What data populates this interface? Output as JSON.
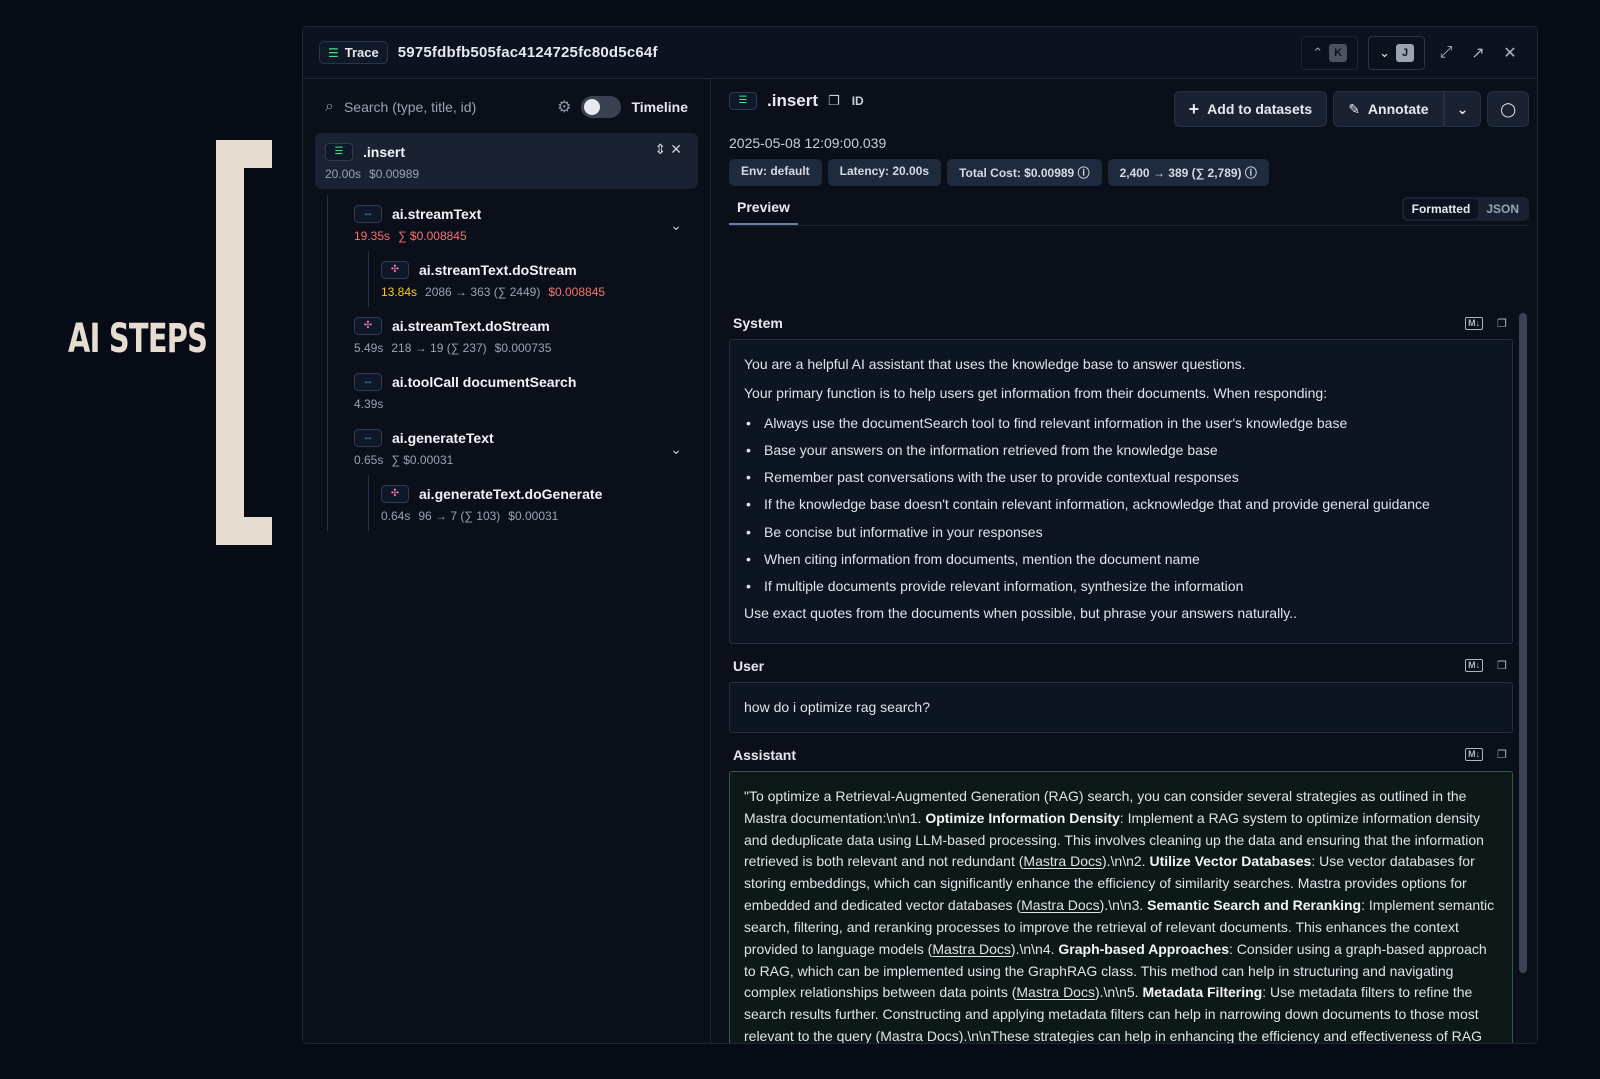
{
  "annotation": {
    "label": "AI STEPS"
  },
  "topbar": {
    "trace_label": "Trace",
    "trace_id": "5975fdbfb505fac4124725fc80d5c64f",
    "prev_key": "K",
    "next_key": "J"
  },
  "sidebar": {
    "search_placeholder": "Search (type, title, id)",
    "timeline_label": "Timeline",
    "root": {
      "title": ".insert",
      "duration": "20.00s",
      "cost": "$0.00989"
    },
    "nodes": [
      {
        "title": "ai.streamText",
        "duration": "19.35s",
        "cost": "∑ $0.008845"
      },
      {
        "title": "ai.streamText.doStream",
        "duration": "13.84s",
        "tokens": "2086 → 363 (∑ 2449)",
        "cost": "$0.008845"
      },
      {
        "title": "ai.streamText.doStream",
        "duration": "5.49s",
        "tokens": "218 → 19 (∑ 237)",
        "cost": "$0.000735"
      },
      {
        "title": "ai.toolCall documentSearch",
        "duration": "4.39s"
      },
      {
        "title": "ai.generateText",
        "duration": "0.65s",
        "cost": "∑ $0.00031"
      },
      {
        "title": "ai.generateText.doGenerate",
        "duration": "0.64s",
        "tokens": "96 → 7 (∑ 103)",
        "cost": "$0.00031"
      }
    ]
  },
  "detail": {
    "title": ".insert",
    "id_label": "ID",
    "add_to_datasets": "Add to datasets",
    "annotate": "Annotate",
    "timestamp": "2025-05-08 12:09:00.039",
    "badges": {
      "env": "Env: default",
      "latency": "Latency: 20.00s",
      "cost": "Total Cost: $0.00989",
      "tokens": "2,400 → 389 (∑ 2,789)"
    },
    "tab_preview": "Preview",
    "fmt_formatted": "Formatted",
    "fmt_json": "JSON",
    "system": {
      "label": "System",
      "intro": "You are a helpful AI assistant that uses the knowledge base to answer questions.",
      "primary": "Your primary function is to help users get information from their documents. When responding:",
      "bullets": [
        "Always use the documentSearch tool to find relevant information in the user's knowledge base",
        "Base your answers on the information retrieved from the knowledge base",
        "Remember past conversations with the user to provide contextual responses",
        "If the knowledge base doesn't contain relevant information, acknowledge that and provide general guidance",
        "Be concise but informative in your responses",
        "When citing information from documents, mention the document name",
        "If multiple documents provide relevant information, synthesize the information"
      ],
      "outro": "Use exact quotes from the documents when possible, but phrase your answers naturally.."
    },
    "user": {
      "label": "User",
      "text": "how do i optimize rag search?"
    },
    "assistant": {
      "label": "Assistant",
      "t1": "\"To optimize a Retrieval-Augmented Generation (RAG) search, you can consider several strategies as outlined in the Mastra documentation:\\n\\n1. ",
      "b1": "Optimize Information Density",
      "t2": ": Implement a RAG system to optimize information density and deduplicate data using LLM-based processing. This involves cleaning up the data and ensuring that the information retrieved is both relevant and not redundant (",
      "link": "Mastra Docs",
      "t3": ").\\n\\n2. ",
      "b2": "Utilize Vector Databases",
      "t4": ": Use vector databases for storing embeddings, which can significantly enhance the efficiency of similarity searches. Mastra provides options for embedded and dedicated vector databases (",
      "t5": ").\\n\\n3. ",
      "b3": "Semantic Search and Reranking",
      "t6": ": Implement semantic search, filtering, and reranking processes to improve the retrieval of relevant documents. This enhances the context provided to language models (",
      "t7": ").\\n\\n4. ",
      "b4": "Graph-based Approaches",
      "t8": ": Consider using a graph-based approach to RAG, which can be implemented using the GraphRAG class. This method can help in structuring and navigating complex relationships between data points (",
      "t9": ").\\n\\n5. ",
      "b5": "Metadata Filtering",
      "t10": ": Use metadata filters to refine the search results further. Constructing and applying metadata filters can help in narrowing down documents to those most relevant to the query (",
      "t11": ").\\n\\nThese strategies can help in enhancing the efficiency and effectiveness of RAG systems by ensuring that the most relevant and non-redundant information is retrieved"
    }
  }
}
